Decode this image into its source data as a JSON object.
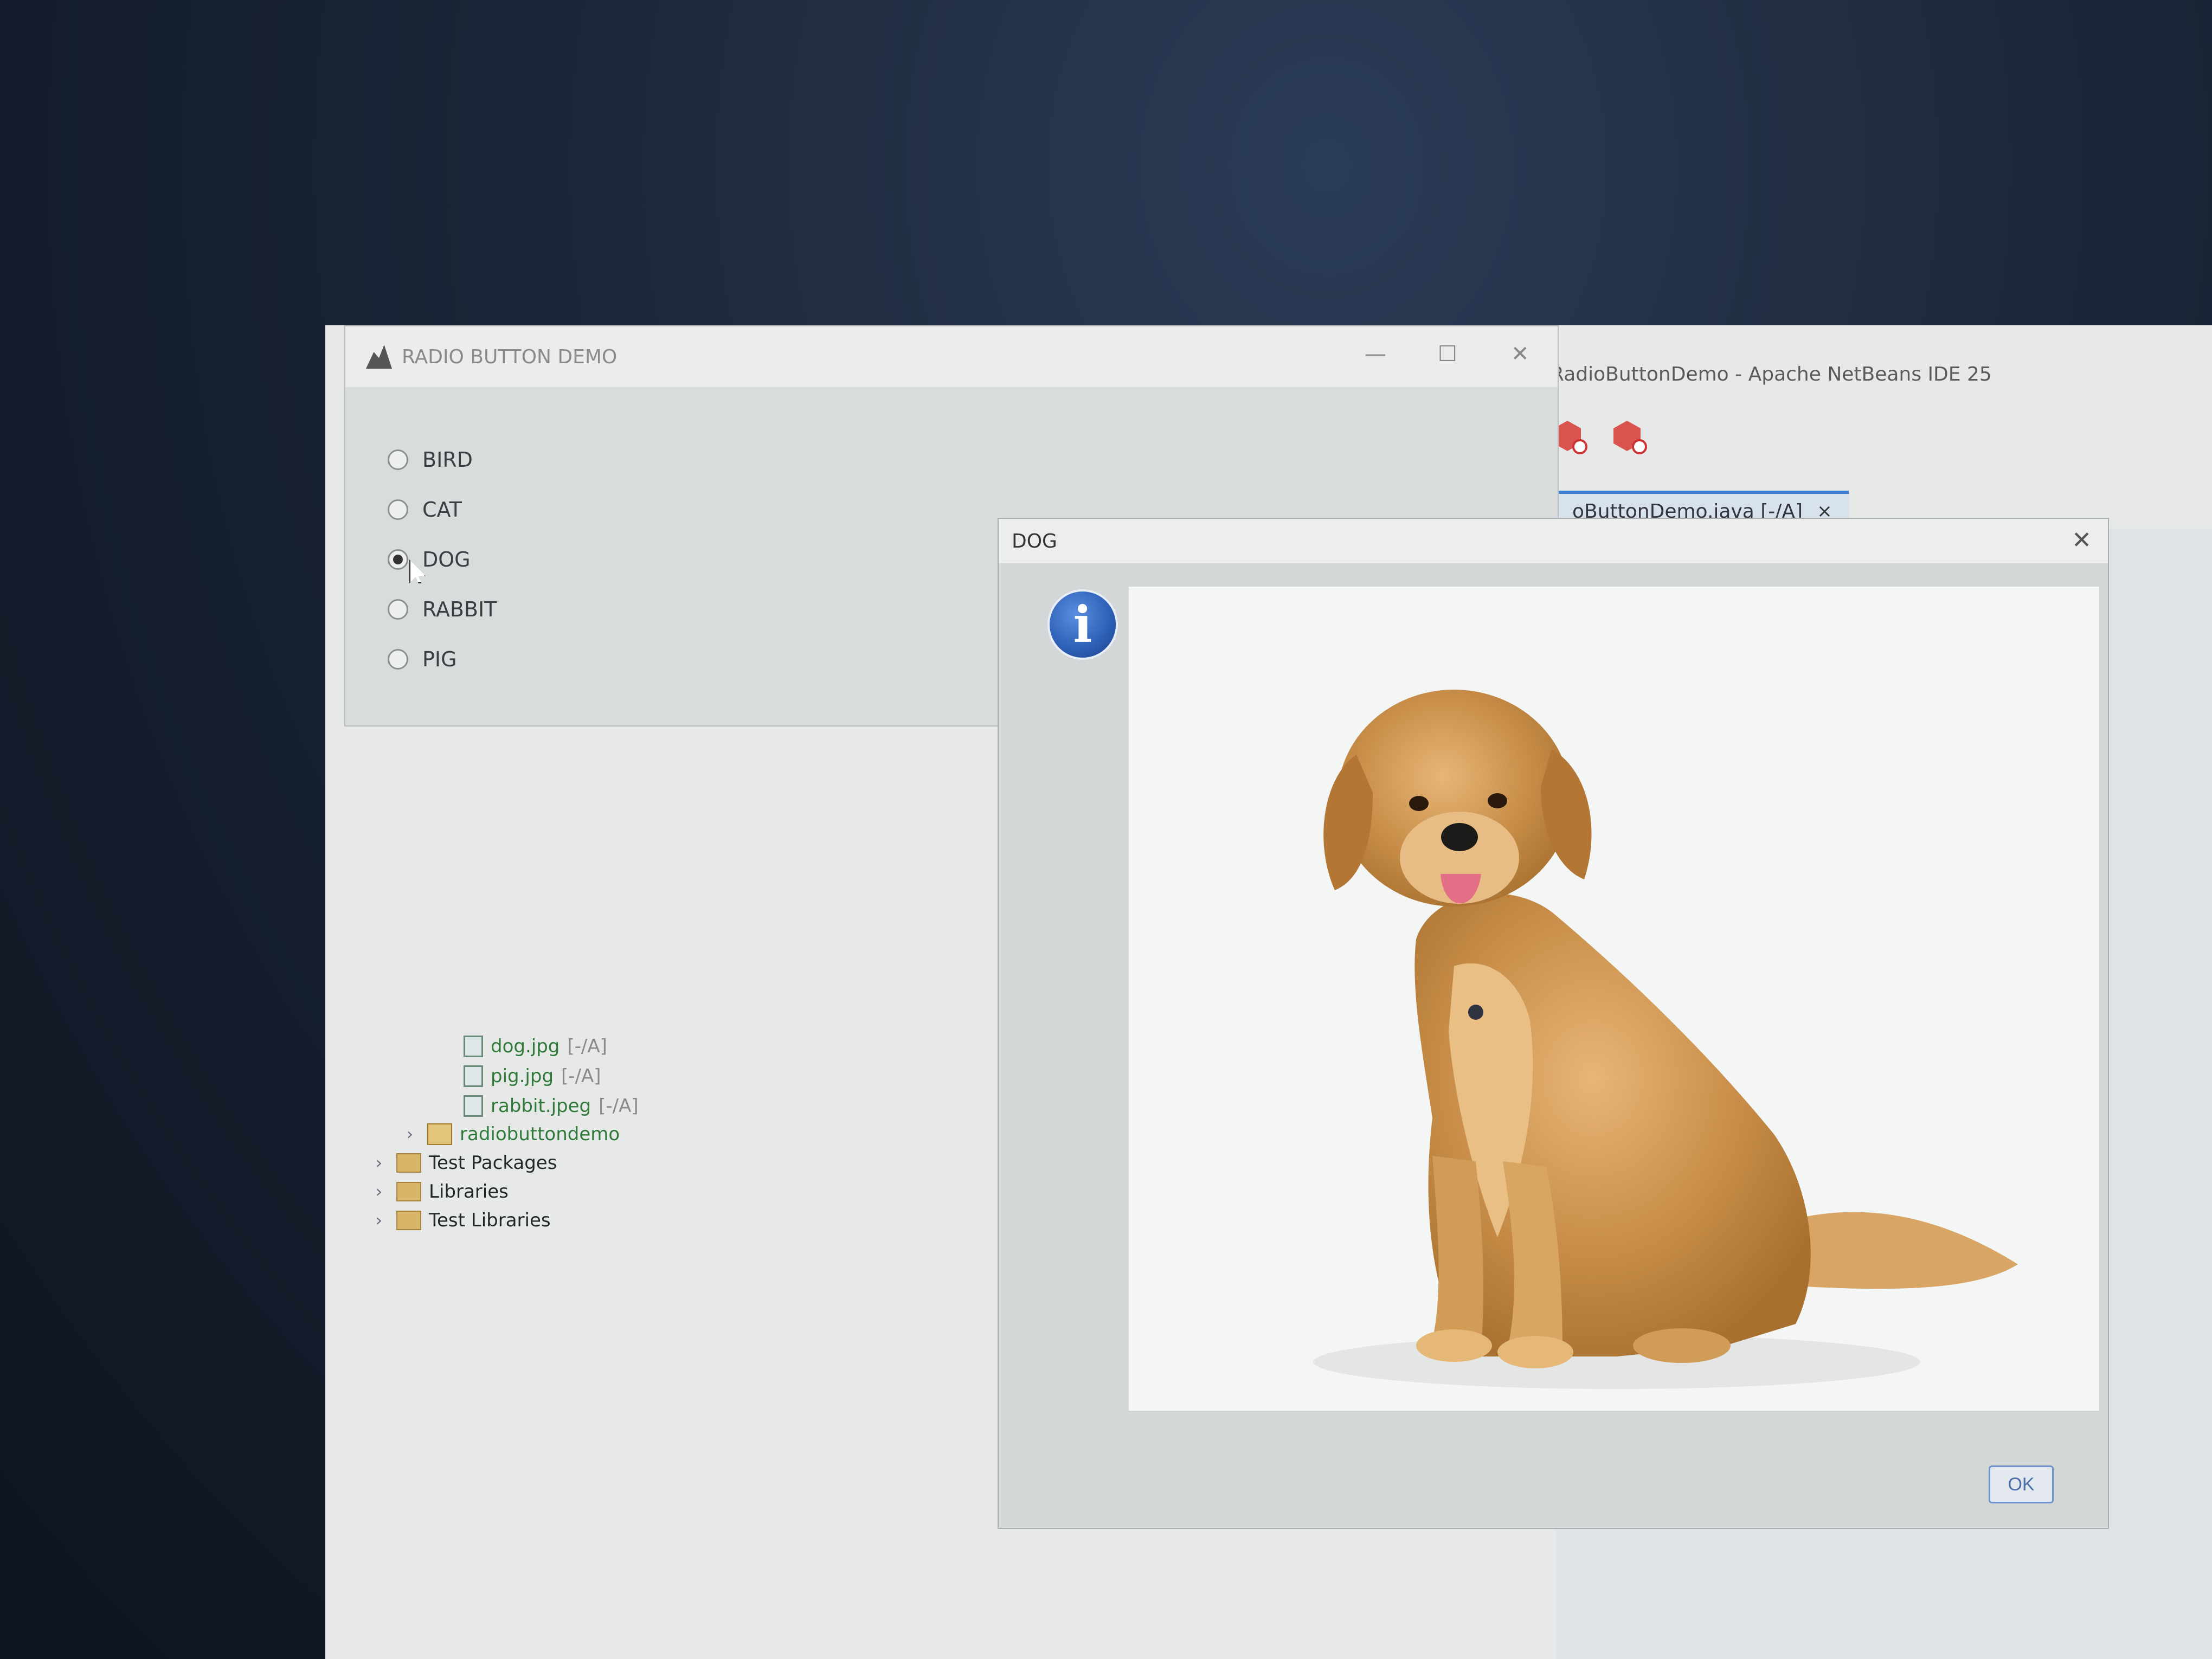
{
  "ide": {
    "title": "RadioButtonDemo - Apache NetBeans IDE 25",
    "tab": {
      "label": "oButtonDemo.java [-/A]",
      "close": "×"
    }
  },
  "tree": [
    {
      "name": "dog.jpg",
      "status": "[-/A]"
    },
    {
      "name": "pig.jpg",
      "status": "[-/A]"
    },
    {
      "name": "rabbit.jpeg",
      "status": "[-/A]"
    },
    {
      "name": "radiobuttondemo"
    },
    {
      "name": "Test Packages"
    },
    {
      "name": "Libraries"
    },
    {
      "name": "Test Libraries"
    }
  ],
  "radio_window": {
    "title": "RADIO BUTTON DEMO",
    "minimize": "—",
    "maximize": "☐",
    "close": "✕",
    "options": [
      "BIRD",
      "CAT",
      "DOG",
      "RABBIT",
      "PIG"
    ],
    "selected": "DOG"
  },
  "dialog": {
    "title": "DOG",
    "close": "✕",
    "info_glyph": "i",
    "ok_label": "OK"
  }
}
